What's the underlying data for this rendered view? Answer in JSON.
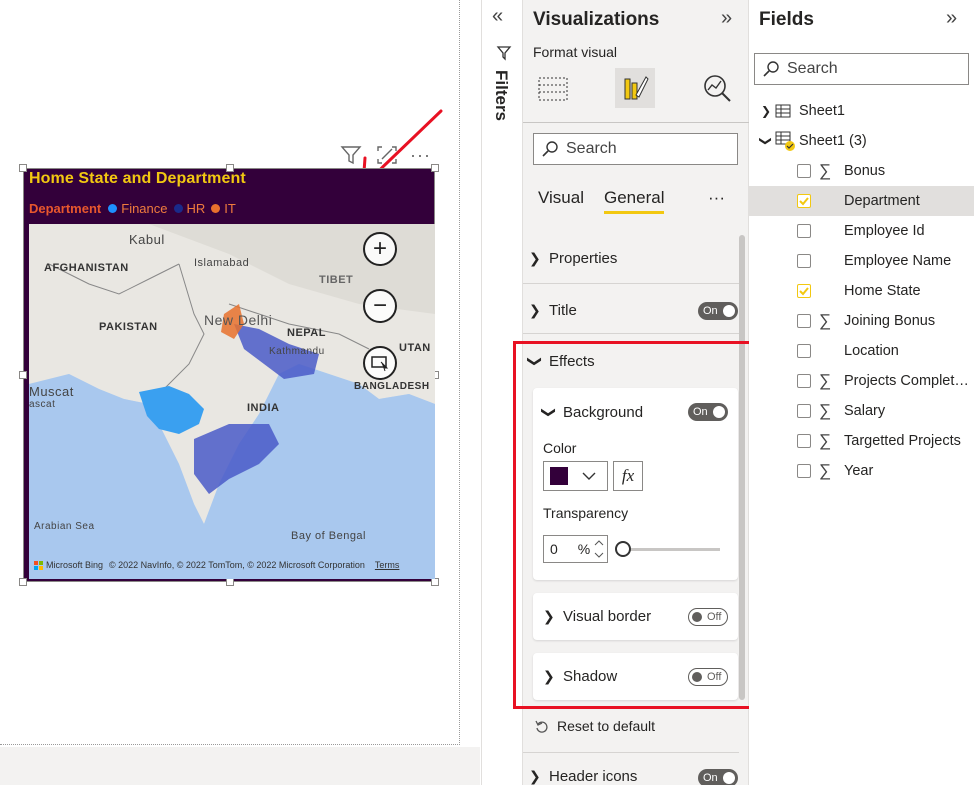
{
  "visual": {
    "title": "Home State and Department",
    "legend": {
      "label": "Department",
      "items": [
        {
          "label": "Finance",
          "color": "#1e90ff"
        },
        {
          "label": "HR",
          "color": "#1a2a8a"
        },
        {
          "label": "IT",
          "color": "#e8712d"
        }
      ]
    },
    "background_color": "#33003a",
    "map": {
      "labels": {
        "kabul": "Kabul",
        "afghanistan": "AFGHANISTAN",
        "islamabad": "Islamabad",
        "tibet": "TIBET",
        "pakistan": "PAKISTAN",
        "new_delhi": "New Delhi",
        "nepal": "NEPAL",
        "kathmandu": "Kathmandu",
        "bhutan": "UTAN",
        "bangladesh": "BANGLADESH",
        "muscat": "Muscat",
        "muscat_sub": "ascat",
        "india": "INDIA",
        "arabian_sea": "Arabian Sea",
        "bay_of_bengal": "Bay of Bengal"
      },
      "zoom_in": "+",
      "zoom_out": "−",
      "attribution": {
        "logo": "Microsoft Bing",
        "copyright": "© 2022 NavInfo, © 2022 TomTom, © 2022 Microsoft Corporation",
        "terms": "Terms"
      }
    },
    "header_icons": [
      "filter-icon",
      "focus-mode-icon",
      "more-options-icon"
    ],
    "more_options": "···"
  },
  "filters": {
    "label": "Filters",
    "collapse": "«"
  },
  "visualizations": {
    "title": "Visualizations",
    "expand": "»",
    "format_label": "Format visual",
    "search_placeholder": "Search",
    "tabs": {
      "visual": "Visual",
      "general": "General",
      "more": "···"
    },
    "sections": {
      "properties": "Properties",
      "title": "Title",
      "title_toggle": "On",
      "effects": "Effects",
      "background": "Background",
      "background_toggle": "On",
      "color_label": "Color",
      "color_value": "#33003a",
      "fx": "fx",
      "transparency_label": "Transparency",
      "transparency_value": "0",
      "transparency_unit": "%",
      "visual_border": "Visual border",
      "visual_border_toggle": "Off",
      "shadow": "Shadow",
      "shadow_toggle": "Off",
      "reset": "Reset to default",
      "header_icons": "Header icons",
      "header_icons_toggle": "On"
    }
  },
  "fields": {
    "title": "Fields",
    "expand": "»",
    "search_placeholder": "Search",
    "tables": [
      {
        "name": "Sheet1",
        "expanded": false
      },
      {
        "name": "Sheet1 (3)",
        "expanded": true
      }
    ],
    "items": [
      {
        "name": "Bonus",
        "sigma": true,
        "checked": false
      },
      {
        "name": "Department",
        "sigma": false,
        "checked": true
      },
      {
        "name": "Employee Id",
        "sigma": false,
        "checked": false
      },
      {
        "name": "Employee Name",
        "sigma": false,
        "checked": false
      },
      {
        "name": "Home State",
        "sigma": false,
        "checked": true
      },
      {
        "name": "Joining Bonus",
        "sigma": true,
        "checked": false
      },
      {
        "name": "Location",
        "sigma": false,
        "checked": false
      },
      {
        "name": "Projects Completed",
        "sigma": true,
        "checked": false
      },
      {
        "name": "Salary",
        "sigma": true,
        "checked": false
      },
      {
        "name": "Targetted Projects",
        "sigma": true,
        "checked": false
      },
      {
        "name": "Year",
        "sigma": true,
        "checked": false
      }
    ]
  }
}
